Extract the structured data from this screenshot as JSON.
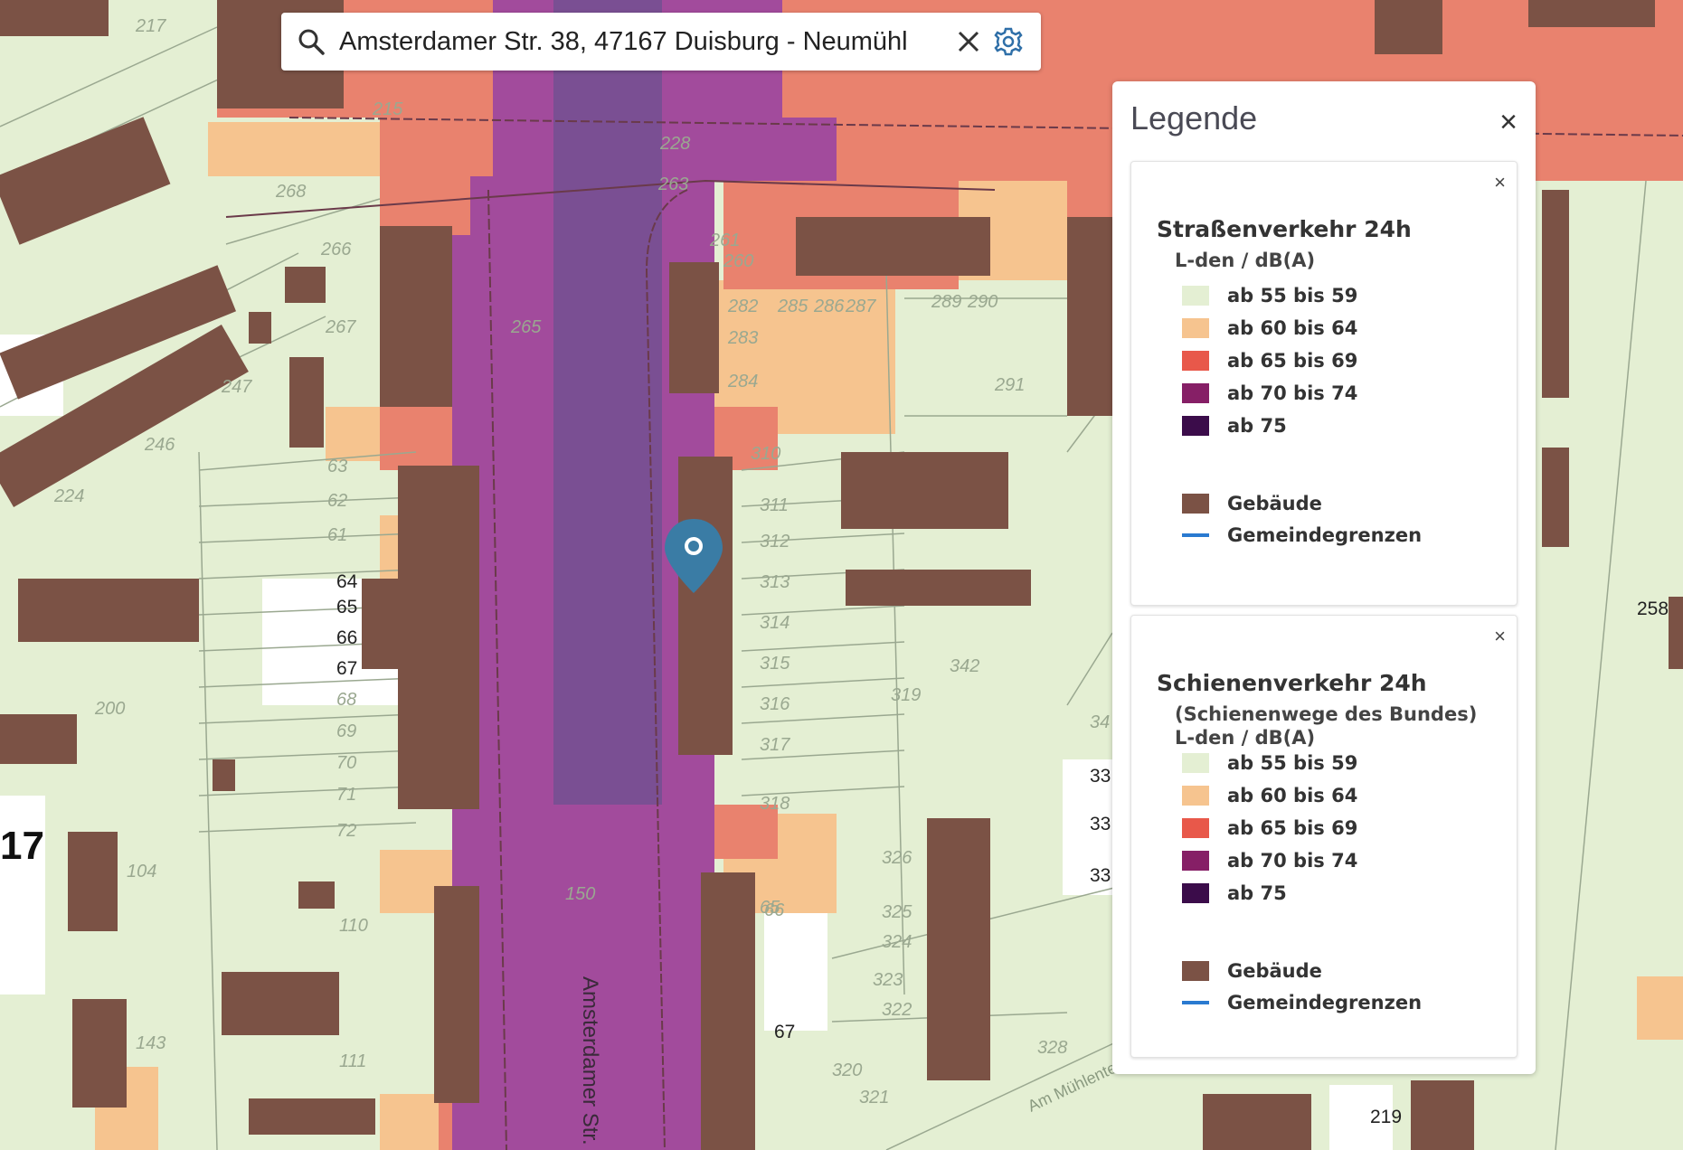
{
  "search": {
    "value": "Amsterdamer Str. 38, 47167 Duisburg - Neumühl",
    "clear_label": "✕"
  },
  "legend": {
    "title": "Legende",
    "close_label": "×",
    "sections": [
      {
        "close_label": "×",
        "title": "Straßenverkehr 24h",
        "subtitle_lines": [
          "L-den / dB(A)"
        ],
        "items": [
          {
            "label": "ab 55 bis 59",
            "color": "#e4efd3"
          },
          {
            "label": "ab 60 bis 64",
            "color": "#f6c48f"
          },
          {
            "label": "ab 65 bis 69",
            "color": "#e8584a"
          },
          {
            "label": "ab 70 bis 74",
            "color": "#861f66"
          },
          {
            "label": "ab 75",
            "color": "#3b0c4a"
          }
        ],
        "extras": [
          {
            "label": "Gebäude",
            "type": "fill",
            "color": "#7b5245"
          },
          {
            "label": "Gemeindegrenzen",
            "type": "line",
            "color": "#2a7ad0"
          }
        ]
      },
      {
        "close_label": "×",
        "title": "Schienenverkehr 24h",
        "subtitle_lines": [
          "(Schienenwege des Bundes)",
          "L-den / dB(A)"
        ],
        "items": [
          {
            "label": "ab 55 bis 59",
            "color": "#e4efd3"
          },
          {
            "label": "ab 60 bis 64",
            "color": "#f6c48f"
          },
          {
            "label": "ab 65 bis 69",
            "color": "#e8584a"
          },
          {
            "label": "ab 70 bis 74",
            "color": "#861f66"
          },
          {
            "label": "ab 75",
            "color": "#3b0c4a"
          }
        ],
        "extras": [
          {
            "label": "Gebäude",
            "type": "fill",
            "color": "#7b5245"
          },
          {
            "label": "Gemeindegrenzen",
            "type": "line",
            "color": "#2a7ad0"
          }
        ]
      }
    ]
  },
  "map": {
    "street_label": "Amsterdamer Str.",
    "street_label_2": "Am Mühlenteich",
    "colors": {
      "base": "#e4efd3",
      "level_60": "#f6c48f",
      "level_65": "#e9826e",
      "level_70": "#a24b9c",
      "level_75": "#7a4f93",
      "building": "#7b5245",
      "parcel_line": "#9aa890",
      "marker": "#3a7ca5"
    },
    "parcel_numbers_dark": [
      "64",
      "65",
      "66",
      "67",
      "67",
      "219",
      "33",
      "33",
      "33",
      "258"
    ],
    "parcel_numbers_light": [
      "217",
      "215",
      "228",
      "263",
      "261",
      "260",
      "268",
      "266",
      "265",
      "267",
      "247",
      "246",
      "224",
      "63",
      "62",
      "61",
      "68",
      "69",
      "70",
      "71",
      "72",
      "200",
      "104",
      "110",
      "143",
      "111",
      "150",
      "282",
      "283",
      "284",
      "285",
      "286",
      "287",
      "289",
      "290",
      "291",
      "310",
      "311",
      "312",
      "313",
      "314",
      "315",
      "316",
      "317",
      "318",
      "319",
      "320",
      "321",
      "322",
      "323",
      "324",
      "325",
      "326",
      "328",
      "342",
      "34",
      "65",
      "66"
    ],
    "sheet_label": "17"
  }
}
